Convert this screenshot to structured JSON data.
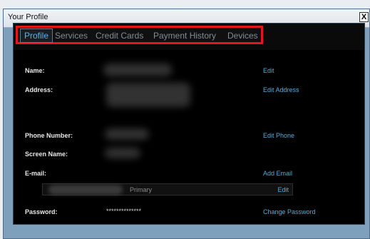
{
  "window": {
    "title": "Your Profile",
    "close_label": "X"
  },
  "tabs": [
    "Profile",
    "Services",
    "Credit Cards",
    "Payment History",
    "Devices"
  ],
  "profile": {
    "name_label": "Name:",
    "name_action": "Edit",
    "address_label": "Address:",
    "address_action": "Edit Address",
    "phone_label": "Phone Number:",
    "phone_action": "Edit Phone",
    "screen_name_label": "Screen Name:",
    "email_label": "E-mail:",
    "email_action": "Add Email",
    "email_tag": "Primary",
    "email_edit": "Edit",
    "password_label": "Password:",
    "password_value": "**************",
    "password_action": "Change Password"
  }
}
